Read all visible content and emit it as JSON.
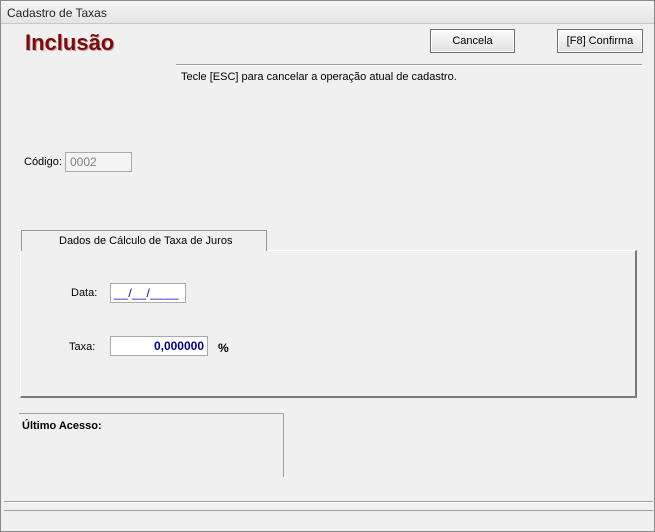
{
  "window": {
    "title": "Cadastro de Taxas"
  },
  "header": {
    "mode": "Inclusão"
  },
  "toolbar": {
    "cancel_label": "Cancela",
    "confirm_label": "[F8]  Confirma"
  },
  "hint": "Tecle [ESC] para cancelar a operação atual de cadastro.",
  "codigo": {
    "label": "Código:",
    "value": "0002"
  },
  "tab": {
    "label": "Dados de Cálculo de Taxa de Juros"
  },
  "form": {
    "data_label": "Data:",
    "data_value": "__/__/____",
    "taxa_label": "Taxa:",
    "taxa_value": "0,000000",
    "taxa_unit": "%"
  },
  "last_access": {
    "label": "Último Acesso:"
  },
  "colors": {
    "mode_text": "#7a0c0c",
    "field_text": "#0000a0"
  }
}
